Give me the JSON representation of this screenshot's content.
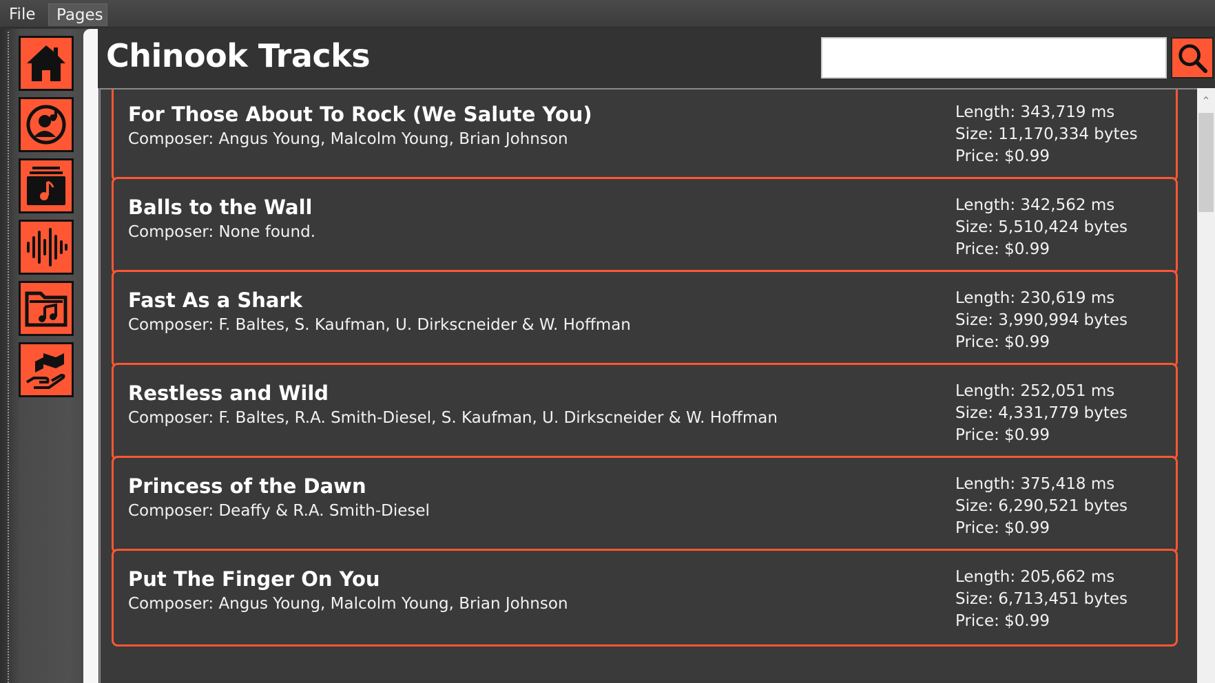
{
  "menubar": {
    "items": [
      "File",
      "Pages"
    ]
  },
  "sidebar": {
    "items": [
      {
        "icon": "home-icon"
      },
      {
        "icon": "artist-icon"
      },
      {
        "icon": "album-icon"
      },
      {
        "icon": "audio-wave-icon"
      },
      {
        "icon": "music-folder-icon"
      },
      {
        "icon": "delivery-hand-icon"
      }
    ],
    "accent": "#ff5733"
  },
  "header": {
    "title": "Chinook Tracks",
    "search": {
      "value": "",
      "placeholder": ""
    }
  },
  "tracks": [
    {
      "name": "For Those About To Rock (We Salute You)",
      "composer": "Composer: Angus Young, Malcolm Young, Brian Johnson",
      "length": "Length: 343,719 ms",
      "size": "Size: 11,170,334 bytes",
      "price": "Price: $0.99"
    },
    {
      "name": "Balls to the Wall",
      "composer": "Composer: None found.",
      "length": "Length: 342,562 ms",
      "size": "Size: 5,510,424 bytes",
      "price": "Price: $0.99"
    },
    {
      "name": "Fast As a Shark",
      "composer": "Composer: F. Baltes, S. Kaufman, U. Dirkscneider & W. Hoffman",
      "length": "Length: 230,619 ms",
      "size": "Size: 3,990,994 bytes",
      "price": "Price: $0.99"
    },
    {
      "name": "Restless and Wild",
      "composer": "Composer: F. Baltes, R.A. Smith-Diesel, S. Kaufman, U. Dirkscneider & W. Hoffman",
      "length": "Length: 252,051 ms",
      "size": "Size: 4,331,779 bytes",
      "price": "Price: $0.99"
    },
    {
      "name": "Princess of the Dawn",
      "composer": "Composer: Deaffy & R.A. Smith-Diesel",
      "length": "Length: 375,418 ms",
      "size": "Size: 6,290,521 bytes",
      "price": "Price: $0.99"
    },
    {
      "name": "Put The Finger On You",
      "composer": "Composer: Angus Young, Malcolm Young, Brian Johnson",
      "length": "Length: 205,662 ms",
      "size": "Size: 6,713,451 bytes",
      "price": "Price: $0.99"
    }
  ]
}
